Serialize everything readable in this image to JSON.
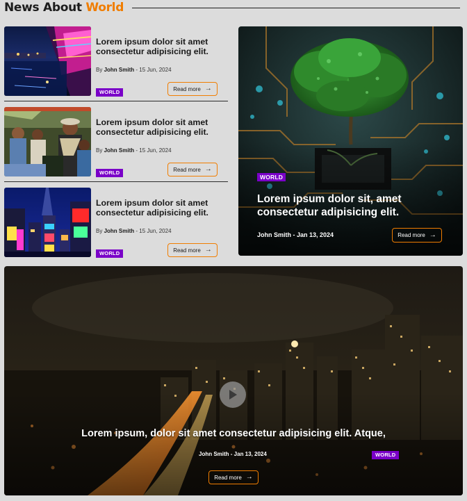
{
  "section": {
    "title_prefix": "News About",
    "title_accent": "World"
  },
  "articles": [
    {
      "title": "Lorem ipsum dolor sit amet consectetur adipisicing elit.",
      "by": "By",
      "author": "John Smith",
      "date": "- 15 Jun, 2024",
      "category": "WORLD",
      "cta": "Read more",
      "image": "night-city-boat"
    },
    {
      "title": "Lorem ipsum dolor sit amet consectetur adipisicing elit.",
      "by": "By",
      "author": "John Smith",
      "date": "- 15 Jun, 2024",
      "category": "WORLD",
      "cta": "Read more",
      "image": "people-gathering"
    },
    {
      "title": "Lorem ipsum dolor sit amet consectetur adipisicing elit.",
      "by": "By",
      "author": "John Smith",
      "date": "- 15 Jun, 2024",
      "category": "WORLD",
      "cta": "Read more",
      "image": "times-square"
    }
  ],
  "feature": {
    "category": "WORLD",
    "title": "Lorem ipsum dolor sit, amet consectetur adipisicing elit.",
    "meta": "John Smith - Jan 13, 2024",
    "cta": "Read more",
    "image": "tree-on-circuit-board"
  },
  "video": {
    "title": "Lorem ipsum, dolor sit amet consectetur adipisicing elit. Atque,",
    "meta": "John Smith - Jan 13, 2024",
    "category": "WORLD",
    "cta": "Read more",
    "image": "city-night-skyline",
    "play_icon": "play-icon"
  },
  "colors": {
    "accent": "#f07d00",
    "badge": "#7a00c8",
    "background": "#dcdcdc"
  }
}
